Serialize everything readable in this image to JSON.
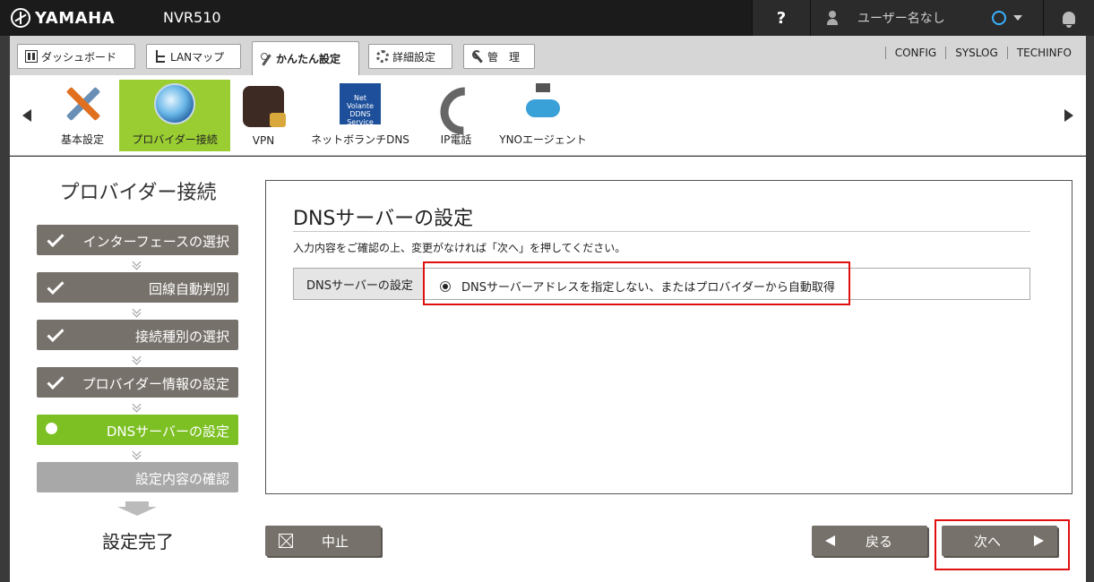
{
  "header": {
    "brand": "YAMAHA",
    "model": "NVR510",
    "help": "?",
    "user": "ユーザー名なし"
  },
  "tabs": [
    {
      "label": "ダッシュボード",
      "icon": "dashboard-icon"
    },
    {
      "label": "LANマップ",
      "icon": "lan-map-icon"
    },
    {
      "label": "かんたん設定",
      "icon": "wand-icon",
      "active": true
    },
    {
      "label": "詳細設定",
      "icon": "gear-icon"
    },
    {
      "label": "管　理",
      "icon": "wrench-icon"
    }
  ],
  "links": [
    "CONFIG",
    "SYSLOG",
    "TECHINFO"
  ],
  "subnav": [
    {
      "label": "基本設定",
      "icon": "tools-icon"
    },
    {
      "label": "プロバイダー接続",
      "icon": "globe-icon",
      "active": true
    },
    {
      "label": "VPN",
      "icon": "vpn-lock-icon"
    },
    {
      "label": "ネットボランチDNS",
      "icon": "ddns-icon",
      "badge": "Net Volante DDNS Service"
    },
    {
      "label": "IP電話",
      "icon": "phone-icon"
    },
    {
      "label": "YNOエージェント",
      "icon": "network-icon"
    }
  ],
  "wizard": {
    "title": "プロバイダー接続",
    "steps": [
      {
        "label": "インターフェースの選択",
        "state": "done"
      },
      {
        "label": "回線自動判別",
        "state": "done"
      },
      {
        "label": "接続種別の選択",
        "state": "done"
      },
      {
        "label": "プロバイダー情報の設定",
        "state": "done"
      },
      {
        "label": "DNSサーバーの設定",
        "state": "current"
      },
      {
        "label": "設定内容の確認",
        "state": "todo"
      }
    ],
    "final": "設定完了"
  },
  "panel": {
    "title": "DNSサーバーの設定",
    "description": "入力内容をご確認の上、変更がなければ「次へ」を押してください。",
    "row_label": "DNSサーバーの設定",
    "option_label": "DNSサーバーアドレスを指定しない、またはプロバイダーから自動取得"
  },
  "buttons": {
    "abort": "中止",
    "back": "戻る",
    "next": "次へ"
  },
  "colors": {
    "accent_green": "#9acd32",
    "step_current": "#7cc023",
    "step_done": "#77716b",
    "highlight": "#e01010"
  }
}
